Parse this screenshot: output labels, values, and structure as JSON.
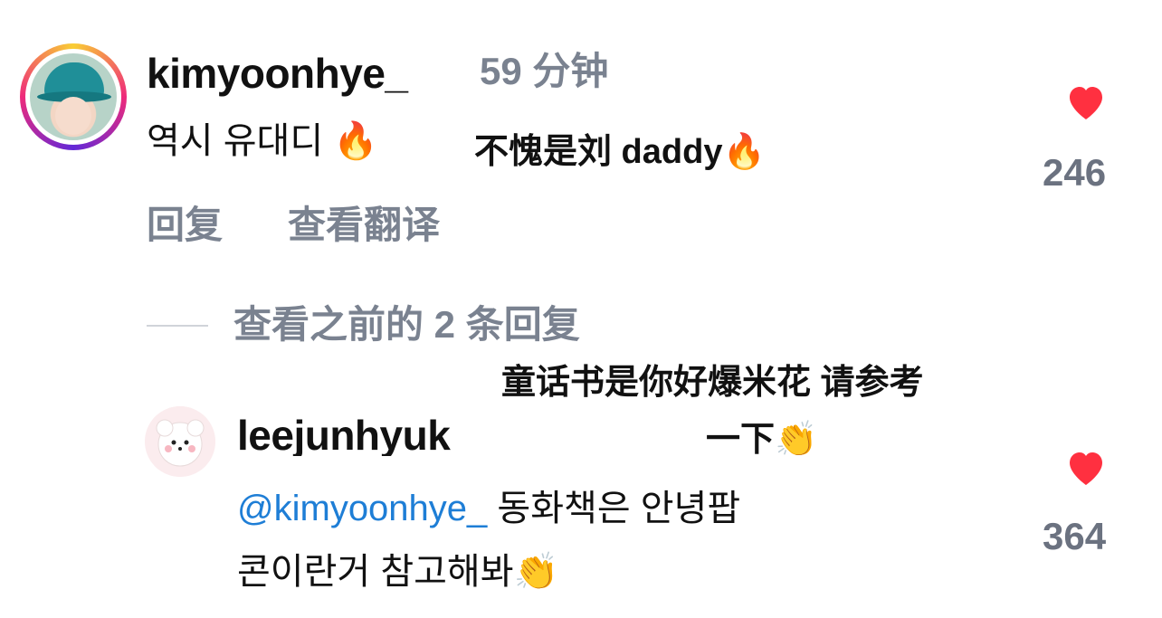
{
  "comments": [
    {
      "username": "kimyoonhye_",
      "time": "59 分钟",
      "text": "역시 유대디",
      "translation_overlay": "不愧是刘 daddy",
      "reply_label": "回复",
      "translate_label": "查看翻译",
      "like_count": "246"
    },
    {
      "username": "leejunhyuk",
      "mention": "@kimyoonhye_",
      "text_line1": "동화책은 안녕팝",
      "text_line2": "콘이란거 참고해봐",
      "translation_overlay_line1": "童话书是你好爆米花 请参考",
      "translation_overlay_line2": "一下",
      "like_count": "364"
    }
  ],
  "view_previous_replies": "查看之前的 2 条回复",
  "icons": {
    "like": "heart-icon",
    "emoji_fire": "fire-emoji",
    "emoji_clap": "clap-emoji"
  },
  "colors": {
    "heart": "#ff3040",
    "mention": "#1e7ed6",
    "secondary": "#7a8290"
  }
}
